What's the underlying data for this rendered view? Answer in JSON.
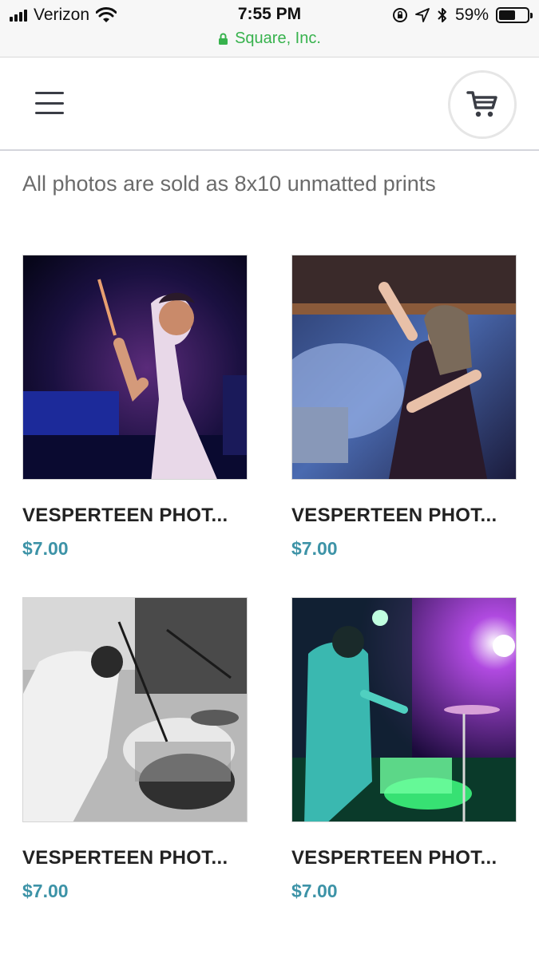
{
  "status_bar": {
    "carrier": "Verizon",
    "time": "7:55 PM",
    "battery": "59%",
    "battery_level": 0.59,
    "url": "Square, Inc.",
    "url_color": "#37b24d"
  },
  "header": {
    "menu_icon": "hamburger-menu-icon",
    "cart_icon": "shopping-cart-icon"
  },
  "notice": "All photos are sold as 8x10 unmatted prints",
  "products": [
    {
      "title": "VESPERTEEN PHOT...",
      "price": "$7.00"
    },
    {
      "title": "VESPERTEEN PHOT...",
      "price": "$7.00"
    },
    {
      "title": "VESPERTEEN PHOT...",
      "price": "$7.00"
    },
    {
      "title": "VESPERTEEN PHOT...",
      "price": "$7.00"
    }
  ],
  "colors": {
    "price": "#3d93a7",
    "title": "#222222",
    "notice": "#6b6b6b"
  }
}
